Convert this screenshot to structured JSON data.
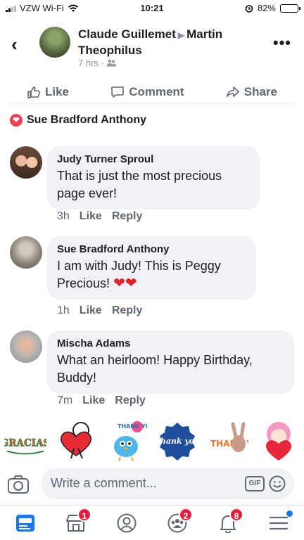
{
  "status": {
    "carrier": "VZW Wi-Fi",
    "time": "10:21",
    "battery": "82%",
    "battery_level": 0.82
  },
  "post_header": {
    "names": "Claude Guillemet",
    "to": "Martin Theophilus",
    "meta": "7 hrs ·"
  },
  "actions": {
    "like": "Like",
    "comment": "Comment",
    "share": "Share"
  },
  "reaction": {
    "name": "Sue Bradford Anthony"
  },
  "comments": [
    {
      "author": "Judy Turner Sproul",
      "text": "That is just the most precious page ever!",
      "time": "3h",
      "like": "Like",
      "reply": "Reply"
    },
    {
      "author": "Sue Bradford Anthony",
      "text": "I am with Judy! This is Peggy Precious!",
      "time": "1h",
      "like": "Like",
      "reply": "Reply"
    },
    {
      "author": "Mischa Adams",
      "text": "What an heirloom! Happy Birthday, Buddy!",
      "time": "7m",
      "like": "Like",
      "reply": "Reply"
    }
  ],
  "stickers": [
    "GRACIAS",
    "THANK YOU!",
    "Thank you",
    "THANK YOU!"
  ],
  "composer": {
    "placeholder": "Write a comment...",
    "gif": "GIF"
  },
  "tabbar": {
    "marketplace_badge": "1",
    "groups_badge": "2",
    "notifications_badge": "8"
  }
}
